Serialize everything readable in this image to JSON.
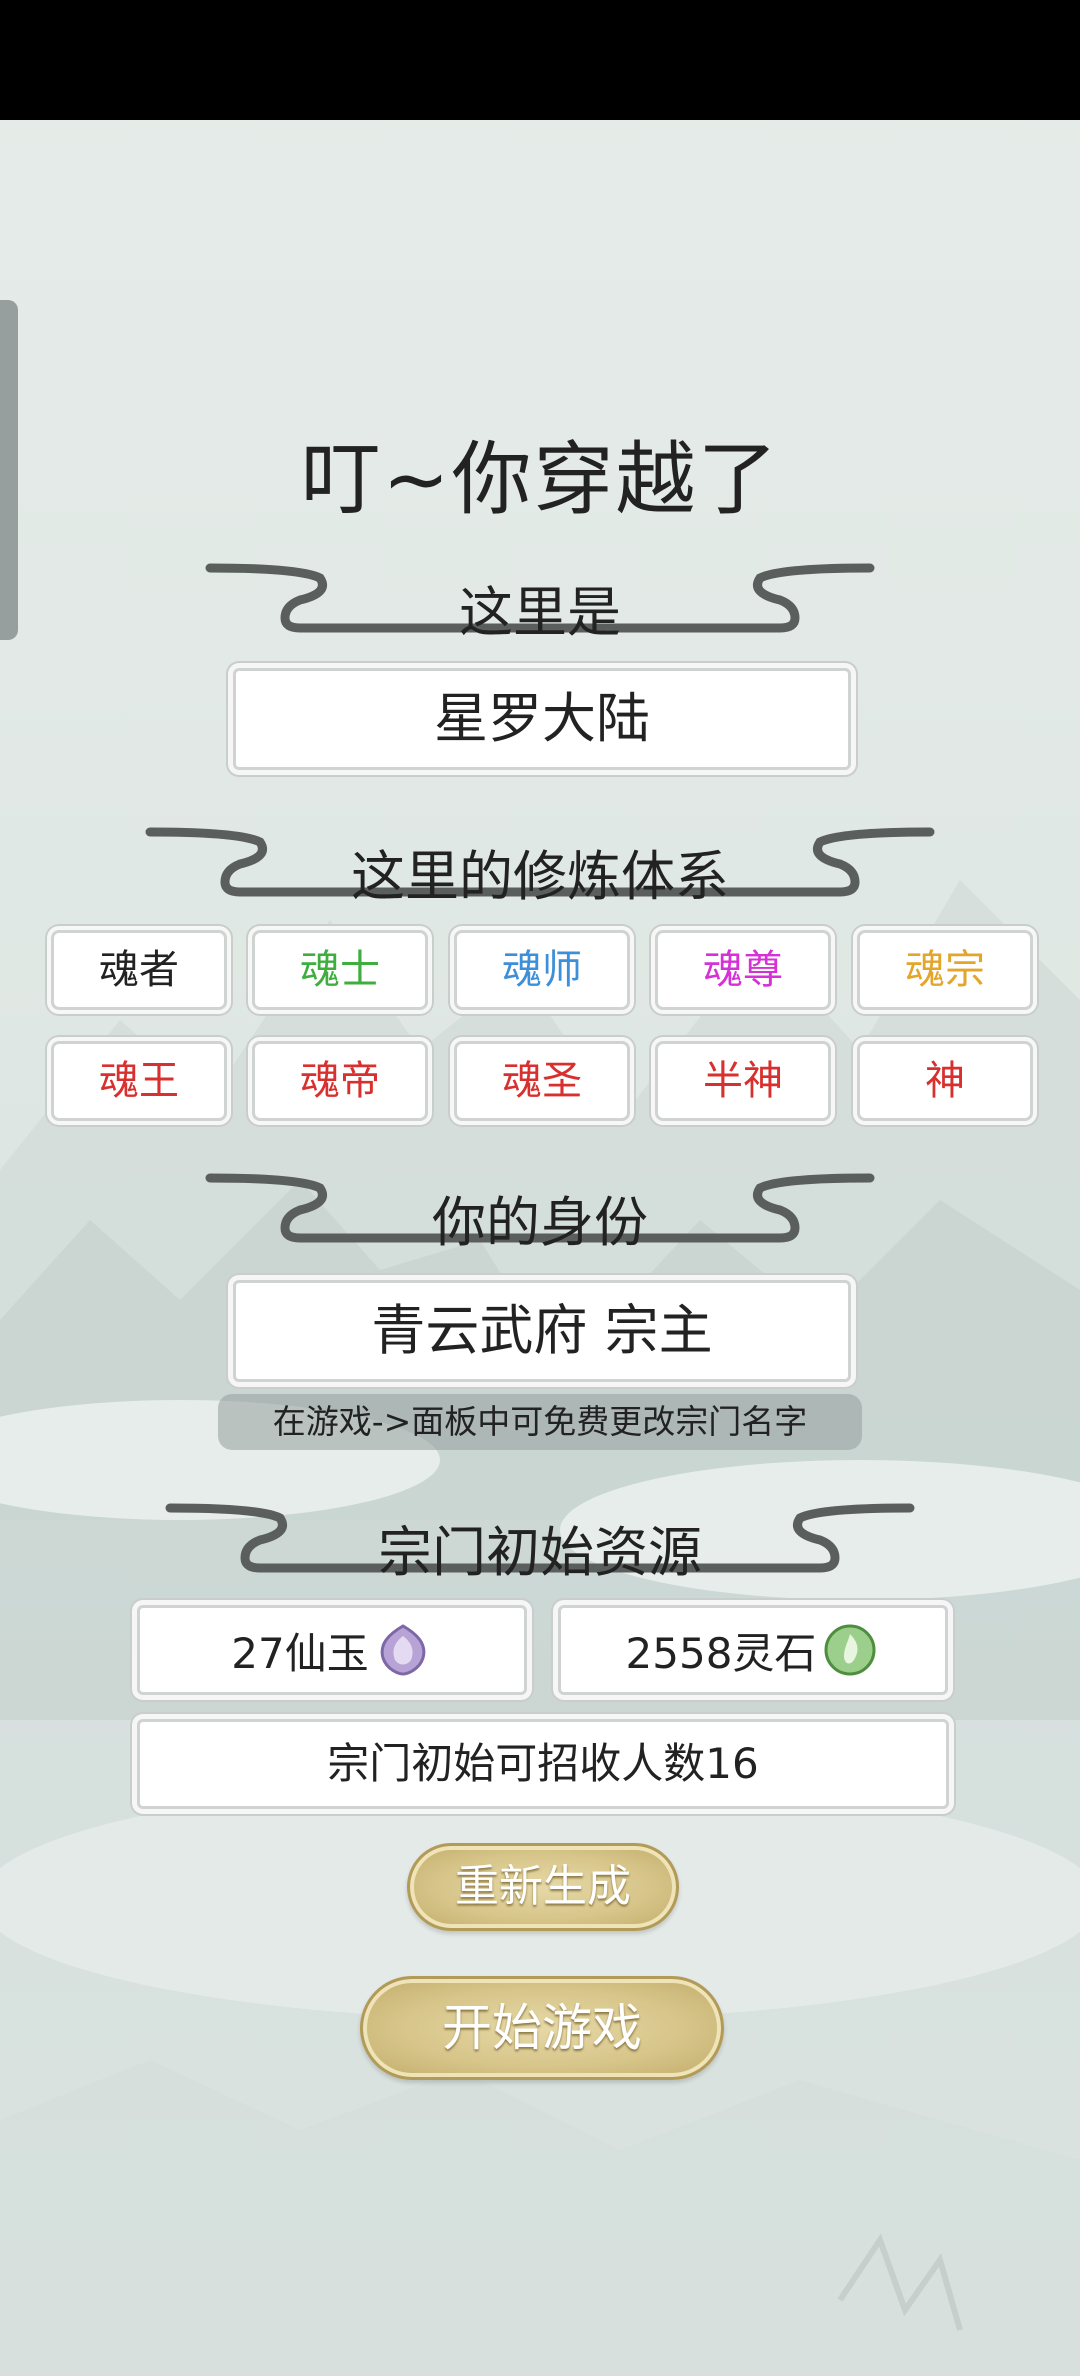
{
  "title": "叮~你穿越了",
  "sections": {
    "location_header": "这里是",
    "location_value": "星罗大陆",
    "cultivation_header": "这里的修炼体系",
    "identity_header": "你的身份",
    "identity_value": "青云武府 宗主",
    "identity_hint": "在游戏->面板中可免费更改宗门名字",
    "resources_header": "宗门初始资源"
  },
  "ranks": [
    {
      "label": "魂者",
      "color": "#222222"
    },
    {
      "label": "魂士",
      "color": "#3fae3f"
    },
    {
      "label": "魂师",
      "color": "#3c8fd8"
    },
    {
      "label": "魂尊",
      "color": "#d631d6"
    },
    {
      "label": "魂宗",
      "color": "#e3a52a"
    },
    {
      "label": "魂王",
      "color": "#d8302e"
    },
    {
      "label": "魂帝",
      "color": "#d8302e"
    },
    {
      "label": "魂圣",
      "color": "#d8302e"
    },
    {
      "label": "半神",
      "color": "#d8302e"
    },
    {
      "label": "神",
      "color": "#d8302e"
    }
  ],
  "resources": {
    "jade": "27仙玉",
    "jade_icon": "purple-jade-icon",
    "spirit_stone": "2558灵石",
    "spirit_stone_icon": "green-spirit-stone-icon",
    "recruit": "宗门初始可招收人数16"
  },
  "buttons": {
    "regenerate": "重新生成",
    "start": "开始游戏"
  }
}
